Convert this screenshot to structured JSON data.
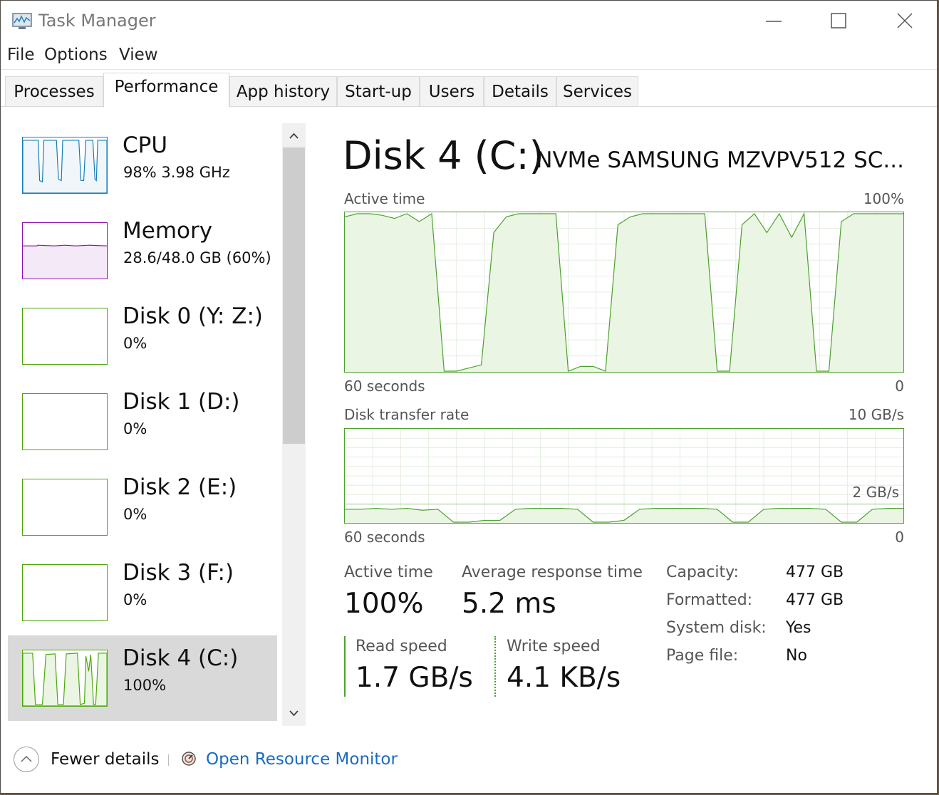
{
  "window": {
    "title": "Task Manager"
  },
  "menu": [
    "File",
    "Options",
    "View"
  ],
  "tabs": [
    "Processes",
    "Performance",
    "App history",
    "Start-up",
    "Users",
    "Details",
    "Services"
  ],
  "active_tab": "Performance",
  "sidebar": {
    "items": [
      {
        "name": "CPU",
        "sub": "98%  3.98 GHz",
        "color": "#117dbb",
        "icon": "cpu-graph-icon"
      },
      {
        "name": "Memory",
        "sub": "28.6/48.0 GB (60%)",
        "color": "#8b12ae",
        "icon": "memory-graph-icon"
      },
      {
        "name": "Disk 0 (Y: Z:)",
        "sub": "0%",
        "color": "#4da60c",
        "icon": "disk-graph-icon"
      },
      {
        "name": "Disk 1 (D:)",
        "sub": "0%",
        "color": "#4da60c",
        "icon": "disk-graph-icon"
      },
      {
        "name": "Disk 2 (E:)",
        "sub": "0%",
        "color": "#4da60c",
        "icon": "disk-graph-icon"
      },
      {
        "name": "Disk 3 (F:)",
        "sub": "0%",
        "color": "#4da60c",
        "icon": "disk-graph-icon"
      },
      {
        "name": "Disk 4 (C:)",
        "sub": "100%",
        "color": "#4da60c",
        "icon": "disk-graph-icon",
        "selected": true
      }
    ]
  },
  "main": {
    "title": "Disk 4 (C:)",
    "model": "NVMe SAMSUNG MZVPV512 SC...",
    "active_chart": {
      "label": "Active time",
      "max_label": "100%",
      "time_label": "60 seconds",
      "min_label": "0"
    },
    "transfer_chart": {
      "label": "Disk transfer rate",
      "max_label": "10 GB/s",
      "mid_label": "2 GB/s",
      "time_label": "60 seconds",
      "min_label": "0"
    },
    "stats": {
      "active_time_label": "Active time",
      "active_time_value": "100%",
      "avg_response_label": "Average response time",
      "avg_response_value": "5.2 ms",
      "read_label": "Read speed",
      "read_value": "1.7 GB/s",
      "write_label": "Write speed",
      "write_value": "4.1 KB/s"
    },
    "info": [
      {
        "label": "Capacity:",
        "value": "477 GB"
      },
      {
        "label": "Formatted:",
        "value": "477 GB"
      },
      {
        "label": "System disk:",
        "value": "Yes"
      },
      {
        "label": "Page file:",
        "value": "No"
      }
    ]
  },
  "footer": {
    "fewer_details": "Fewer details",
    "resource_monitor": "Open Resource Monitor"
  },
  "colors": {
    "disk_green": "#4ca12e",
    "disk_fill": "#eaf6e3",
    "link": "#1a6bc0",
    "selected_bg": "#d9d9d9"
  },
  "chart_data": {
    "type": "area",
    "title": "Active time",
    "x_range_seconds": [
      60,
      0
    ],
    "ylim": [
      0,
      100
    ],
    "active_time_percent": [
      98,
      100,
      100,
      99,
      97,
      100,
      95,
      100,
      0,
      0,
      2,
      4,
      88,
      98,
      100,
      100,
      100,
      100,
      0,
      3,
      3,
      0,
      93,
      98,
      100,
      100,
      100,
      100,
      100,
      100,
      0,
      0,
      93,
      100,
      88,
      100,
      85,
      100,
      0,
      0,
      95,
      100,
      100,
      100,
      100,
      100
    ],
    "transfer_rate_gbps": [
      1.4,
      1.4,
      1.5,
      1.4,
      1.5,
      1.3,
      1.4,
      0,
      0,
      0.2,
      0.2,
      1.4,
      1.5,
      1.5,
      1.5,
      1.4,
      0,
      0,
      0.2,
      1.4,
      1.5,
      1.5,
      1.5,
      1.5,
      1.4,
      0,
      0,
      1.4,
      1.5,
      1.5,
      1.5,
      1.4,
      0,
      0,
      1.4,
      1.5,
      1.5
    ]
  }
}
